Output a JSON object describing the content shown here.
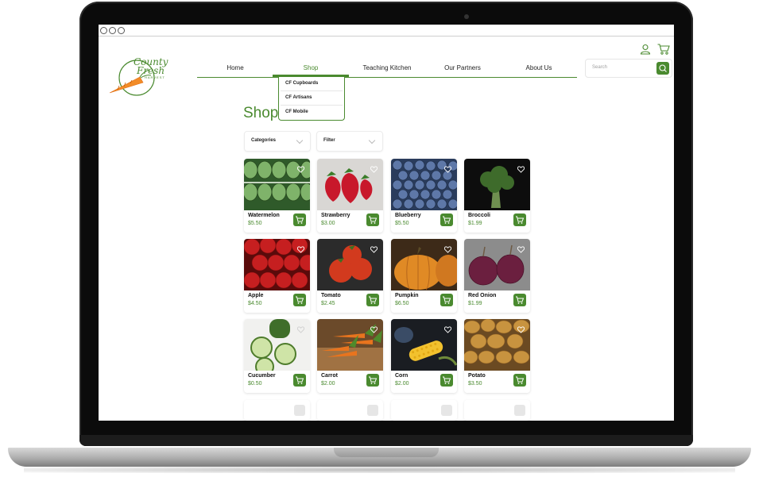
{
  "window": {
    "controls": [
      "close",
      "minimize",
      "maximize"
    ]
  },
  "brand": {
    "line1": "County",
    "line2": "Fresh",
    "sub": "HARVEST",
    "color": "#4a8a2f"
  },
  "nav": {
    "items": [
      {
        "label": "Home",
        "active": false
      },
      {
        "label": "Shop",
        "active": true
      },
      {
        "label": "Teaching Kitchen",
        "active": false
      },
      {
        "label": "Our Partners",
        "active": false
      },
      {
        "label": "About Us",
        "active": false
      }
    ]
  },
  "dropdown": {
    "items": [
      "CF Cupboards",
      "CF Artisans",
      "CF Mobile"
    ]
  },
  "search": {
    "placeholder": "Search",
    "icon": "search-icon"
  },
  "header_icons": {
    "user": "user-icon",
    "cart": "cart-icon"
  },
  "page": {
    "title": "Shop"
  },
  "filters": {
    "categories_label": "Categories",
    "filter_label": "Filter"
  },
  "products": [
    {
      "name": "Watermelon",
      "price": "$5.50"
    },
    {
      "name": "Strawberry",
      "price": "$3.00"
    },
    {
      "name": "Blueberry",
      "price": "$5.50"
    },
    {
      "name": "Broccoli",
      "price": "$1.99"
    },
    {
      "name": "Apple",
      "price": "$4.50"
    },
    {
      "name": "Tomato",
      "price": "$2.45"
    },
    {
      "name": "Pumpkin",
      "price": "$6.50"
    },
    {
      "name": "Red Onion",
      "price": "$1.99"
    },
    {
      "name": "Cucumber",
      "price": "$0.50"
    },
    {
      "name": "Carrot",
      "price": "$2.00"
    },
    {
      "name": "Corn",
      "price": "$2.00"
    },
    {
      "name": "Potato",
      "price": "$3.50"
    }
  ]
}
